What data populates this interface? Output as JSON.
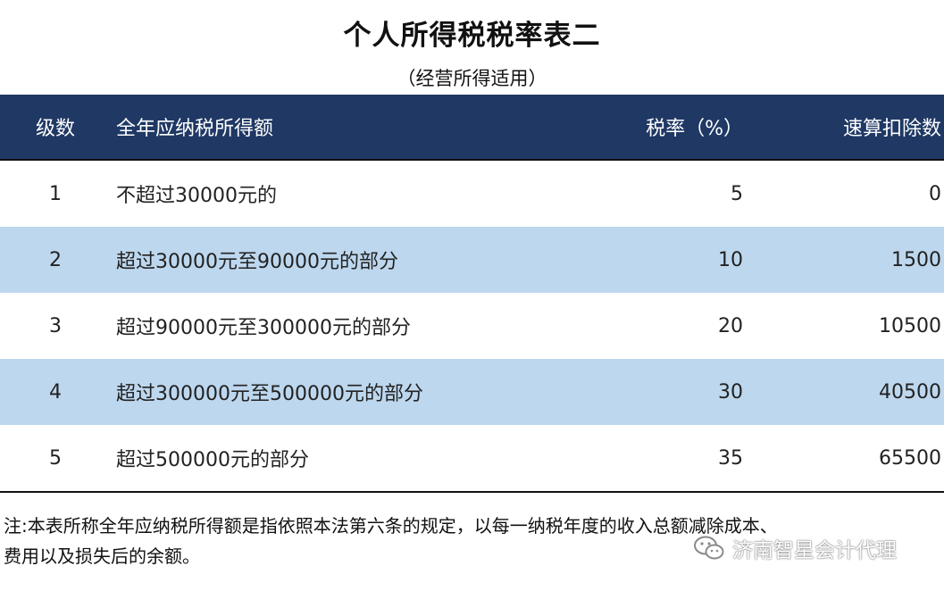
{
  "title": "个人所得税税率表二",
  "subtitle": "（经营所得适用）",
  "table": {
    "headers": {
      "level": "级数",
      "range": "全年应纳税所得额",
      "rate": "税率（%）",
      "deduction": "速算扣除数"
    },
    "rows": [
      {
        "level": "1",
        "range": "不超过30000元的",
        "rate": "5",
        "deduction": "0"
      },
      {
        "level": "2",
        "range": "超过30000元至90000元的部分",
        "rate": "10",
        "deduction": "1500"
      },
      {
        "level": "3",
        "range": "超过90000元至300000元的部分",
        "rate": "20",
        "deduction": "10500"
      },
      {
        "level": "4",
        "range": "超过300000元至500000元的部分",
        "rate": "30",
        "deduction": "40500"
      },
      {
        "level": "5",
        "range": "超过500000元的部分",
        "rate": "35",
        "deduction": "65500"
      }
    ]
  },
  "note": {
    "line1": "注:本表所称全年应纳税所得额是指依照本法第六条的规定，以每一纳税年度的收入总额减除成本、",
    "line2": "费用以及损失后的余额。"
  },
  "watermark": {
    "icon": "wechat-icon",
    "text": "济南智星会计代理"
  },
  "colors": {
    "header_bg": "#1f3864",
    "alt_row_bg": "#bdd7ee"
  }
}
